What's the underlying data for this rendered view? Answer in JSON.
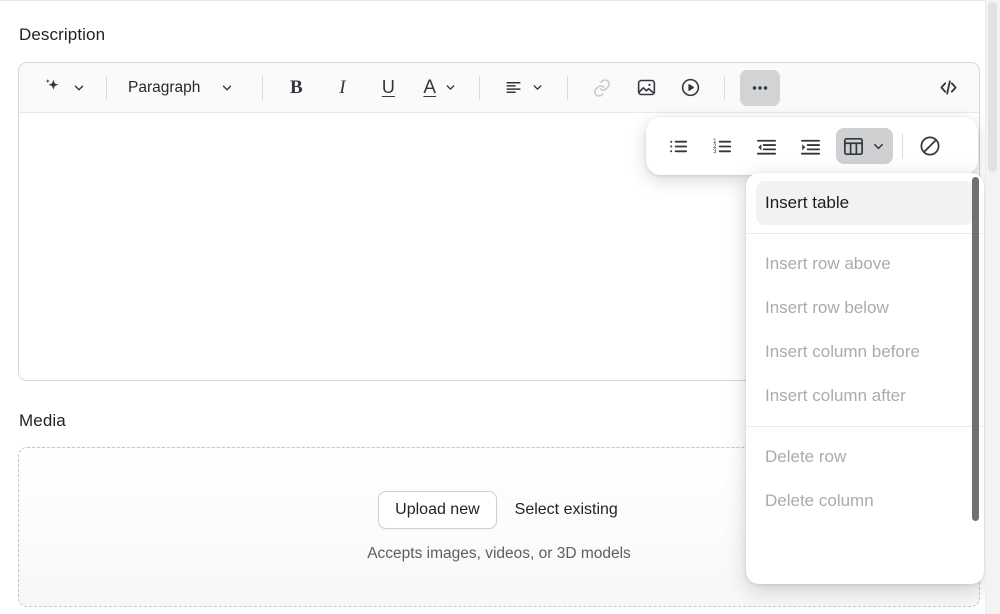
{
  "fields": {
    "description_label": "Description",
    "media_label": "Media"
  },
  "editor_toolbar": {
    "ai_button": "ai-sparkle",
    "ai_caret": "chevron-down",
    "block_format": "Paragraph",
    "block_format_caret": "chevron-down",
    "bold": "B",
    "italic": "I",
    "underline": "U",
    "text_color": "A",
    "text_color_caret": "chevron-down",
    "align": "align-left",
    "align_caret": "chevron-down",
    "link": "link",
    "image": "image",
    "video": "video",
    "more": "ellipsis",
    "code": "code-brackets"
  },
  "float_toolbar": {
    "bullet_list": "bulleted-list",
    "ordered_list": "numbered-list",
    "outdent": "outdent",
    "indent": "indent",
    "table": "table",
    "table_caret": "chevron-down",
    "clear_formatting": "prohibited"
  },
  "table_menu": {
    "items": [
      {
        "label": "Insert table",
        "enabled": true
      },
      {
        "label": "Insert row above",
        "enabled": false
      },
      {
        "label": "Insert row below",
        "enabled": false
      },
      {
        "label": "Insert column before",
        "enabled": false
      },
      {
        "label": "Insert column after",
        "enabled": false
      },
      {
        "label": "Delete row",
        "enabled": false
      },
      {
        "label": "Delete column",
        "enabled": false
      }
    ]
  },
  "media": {
    "upload_button": "Upload new",
    "select_existing": "Select existing",
    "hint": "Accepts images, videos, or 3D models"
  },
  "colors": {
    "text_primary": "#1f2124",
    "text_disabled": "#aaabae",
    "toolbar_bg": "#fafafa",
    "active_button_bg": "#cfd0d2",
    "menu_hover_bg": "#f2f2f3",
    "border": "#d6d6d6",
    "dashed_border": "#c6c6c6",
    "scroll_thumb": "#6f7073"
  }
}
